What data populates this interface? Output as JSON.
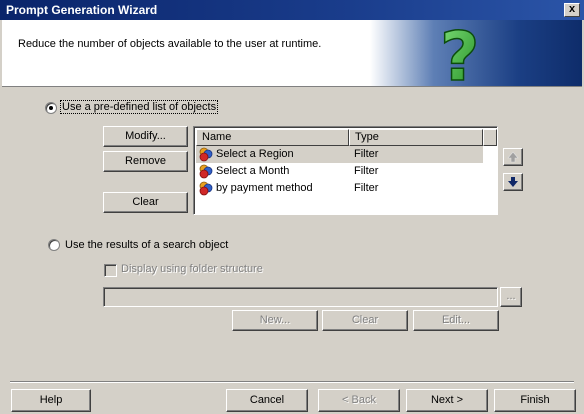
{
  "window": {
    "title": "Prompt Generation Wizard",
    "close_label": "x"
  },
  "header": {
    "instruction": "Reduce the number of objects available to the user at runtime.",
    "art_symbol": "?"
  },
  "option_predefined": {
    "label": "Use a pre-defined list of objects",
    "selected": true
  },
  "buttons_left": {
    "modify": "Modify...",
    "remove": "Remove",
    "clear": "Clear"
  },
  "objects_list": {
    "columns": [
      "Name",
      "Type"
    ],
    "rows": [
      {
        "name": "Select a Region",
        "type": "Filter",
        "selected": true
      },
      {
        "name": "Select a Month",
        "type": "Filter",
        "selected": false
      },
      {
        "name": "by payment method",
        "type": "Filter",
        "selected": false
      }
    ]
  },
  "reorder": {
    "up_icon": "arrow-up-icon",
    "down_icon": "arrow-down-icon"
  },
  "option_search": {
    "label": "Use the results of a search object",
    "selected": false
  },
  "folder_checkbox": {
    "label": "Display using folder structure",
    "checked": false,
    "enabled": false
  },
  "search_field": {
    "value": "",
    "browse_label": "..."
  },
  "search_buttons": {
    "new": "New...",
    "clear": "Clear",
    "edit": "Edit..."
  },
  "footer": {
    "help": "Help",
    "cancel": "Cancel",
    "back": "< Back",
    "next": "Next >",
    "finish": "Finish"
  },
  "colors": {
    "titlebar": "#0a246a",
    "face": "#d4d0c8",
    "disabled_text": "#808080"
  }
}
